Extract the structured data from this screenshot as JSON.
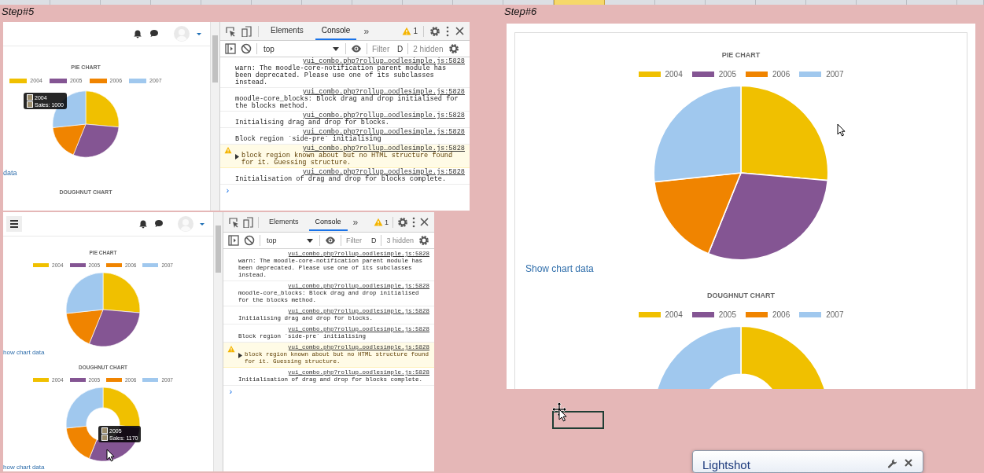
{
  "sheet": {
    "column_headers": [
      {
        "selected": false
      },
      {
        "selected": false
      },
      {
        "selected": false
      },
      {
        "selected": false
      },
      {
        "selected": false
      },
      {
        "selected": false
      },
      {
        "selected": false
      },
      {
        "selected": false
      },
      {
        "selected": false
      },
      {
        "selected": false
      },
      {
        "selected": false
      },
      {
        "selected": true
      },
      {
        "selected": false
      },
      {
        "selected": false
      },
      {
        "selected": false
      },
      {
        "selected": false
      },
      {
        "selected": false
      },
      {
        "selected": false
      },
      {
        "selected": false
      },
      {
        "selected": false
      }
    ]
  },
  "step_labels": [
    "Step#5",
    "Step#6"
  ],
  "captures": [
    {
      "kind": "split",
      "page": {
        "menu_button": false,
        "charts": [
          {
            "title": "PIE CHART",
            "kind": "pie",
            "legend": [
              {
                "label": "2004",
                "color": "#f0c000"
              },
              {
                "label": "2005",
                "color": "#845593"
              },
              {
                "label": "2006",
                "color": "#f08400"
              },
              {
                "label": "2007",
                "color": "#a0c8ee"
              }
            ],
            "tooltip": {
              "series": "2004",
              "text": "Sales: 1000"
            },
            "link": "data"
          },
          {
            "title": "DOUGHNUT CHART"
          }
        ]
      },
      "devtools": {
        "tabs": [
          {
            "label": "Elements",
            "selected": false
          },
          {
            "label": "Console",
            "selected": true
          }
        ],
        "more": "»",
        "warnings": "1",
        "context": "top",
        "filter_placeholder": "Filter",
        "levels": "D",
        "hidden": "2 hidden",
        "messages": [
          {
            "kind": "info",
            "expandable": false,
            "text": "warn: The moodle-core-notification parent module has been deprecated. Please use one of its subclasses instead.",
            "source": "yui_combo.php?rollup…oodlesimple.js:5828"
          },
          {
            "kind": "info",
            "expandable": false,
            "text": "moodle-core_blocks: Block drag and drop initialised for the blocks method.",
            "source": "yui_combo.php?rollup…oodlesimple.js:5828"
          },
          {
            "kind": "info",
            "expandable": false,
            "text": "Initialising drag and drop for blocks.",
            "source": "yui_combo.php?rollup…oodlesimple.js:5828"
          },
          {
            "kind": "info",
            "expandable": false,
            "text": "Block region `side-pre` initialising",
            "source": "yui_combo.php?rollup…oodlesimple.js:5828"
          },
          {
            "kind": "warning",
            "expandable": true,
            "text": "block region known about but no HTML structure found for it. Guessing structure.",
            "source": "yui_combo.php?rollup…oodlesimple.js:5828"
          },
          {
            "kind": "info",
            "expandable": false,
            "text": "Initialisation of drag and drop for blocks complete.",
            "source": "yui_combo.php?rollup…oodlesimple.js:5828"
          }
        ],
        "prompt": "›"
      }
    },
    {
      "kind": "split",
      "page": {
        "menu_button": true,
        "charts": [
          {
            "title": "PIE CHART",
            "kind": "pie",
            "legend": [
              {
                "label": "2004",
                "color": "#f0c000"
              },
              {
                "label": "2005",
                "color": "#845593"
              },
              {
                "label": "2006",
                "color": "#f08400"
              },
              {
                "label": "2007",
                "color": "#a0c8ee"
              }
            ],
            "link": "how chart data"
          },
          {
            "title": "DOUGHNUT CHART",
            "kind": "doughnut",
            "legend": [
              {
                "label": "2004",
                "color": "#f0c000"
              },
              {
                "label": "2005",
                "color": "#845593"
              },
              {
                "label": "2006",
                "color": "#f08400"
              },
              {
                "label": "2007",
                "color": "#a0c8ee"
              }
            ],
            "tooltip": {
              "series": "2005",
              "text": "Sales: 1170"
            },
            "link": "how chart data"
          }
        ]
      },
      "devtools": {
        "tabs": [
          {
            "label": "Elements",
            "selected": false
          },
          {
            "label": "Console",
            "selected": true
          }
        ],
        "more": "»",
        "warnings": "1",
        "context": "top",
        "filter_placeholder": "Filter",
        "levels": "D",
        "hidden": "3 hidden",
        "messages": [
          {
            "kind": "info",
            "expandable": false,
            "text": "warn: The moodle-core-notification parent module has been deprecated. Please use one of its subclasses instead.",
            "source": "yui_combo.php?rollup…oodlesimple.js:5828"
          },
          {
            "kind": "info",
            "expandable": false,
            "text": "moodle-core_blocks: Block drag and drop initialised for the blocks method.",
            "source": "yui_combo.php?rollup…oodlesimple.js:5828"
          },
          {
            "kind": "info",
            "expandable": false,
            "text": "Initialising drag and drop for blocks.",
            "source": "yui_combo.php?rollup…oodlesimple.js:5828"
          },
          {
            "kind": "info",
            "expandable": false,
            "text": "Block region `side-pre` initialising",
            "source": "yui_combo.php?rollup…oodlesimple.js:5828"
          },
          {
            "kind": "warning",
            "expandable": true,
            "text": "block region known about but no HTML structure found for it. Guessing structure.",
            "source": "yui_combo.php?rollup…oodlesimple.js:5828"
          },
          {
            "kind": "info",
            "expandable": false,
            "text": "Initialisation of drag and drop for blocks complete.",
            "source": "yui_combo.php?rollup…oodlesimple.js:5828"
          }
        ],
        "prompt": "›"
      }
    },
    {
      "kind": "page",
      "page": {
        "charts": [
          {
            "title": "PIE CHART",
            "kind": "pie",
            "legend": [
              {
                "label": "2004",
                "color": "#f0c000"
              },
              {
                "label": "2005",
                "color": "#845593"
              },
              {
                "label": "2006",
                "color": "#f08400"
              },
              {
                "label": "2007",
                "color": "#a0c8ee"
              }
            ],
            "link": "Show chart data"
          },
          {
            "title": "DOUGHNUT CHART",
            "kind": "doughnut",
            "legend": [
              {
                "label": "2004",
                "color": "#f0c000"
              },
              {
                "label": "2005",
                "color": "#845593"
              },
              {
                "label": "2006",
                "color": "#f08400"
              },
              {
                "label": "2007",
                "color": "#a0c8ee"
              }
            ]
          }
        ]
      }
    }
  ],
  "lightshot": {
    "title": "Lightshot"
  }
}
